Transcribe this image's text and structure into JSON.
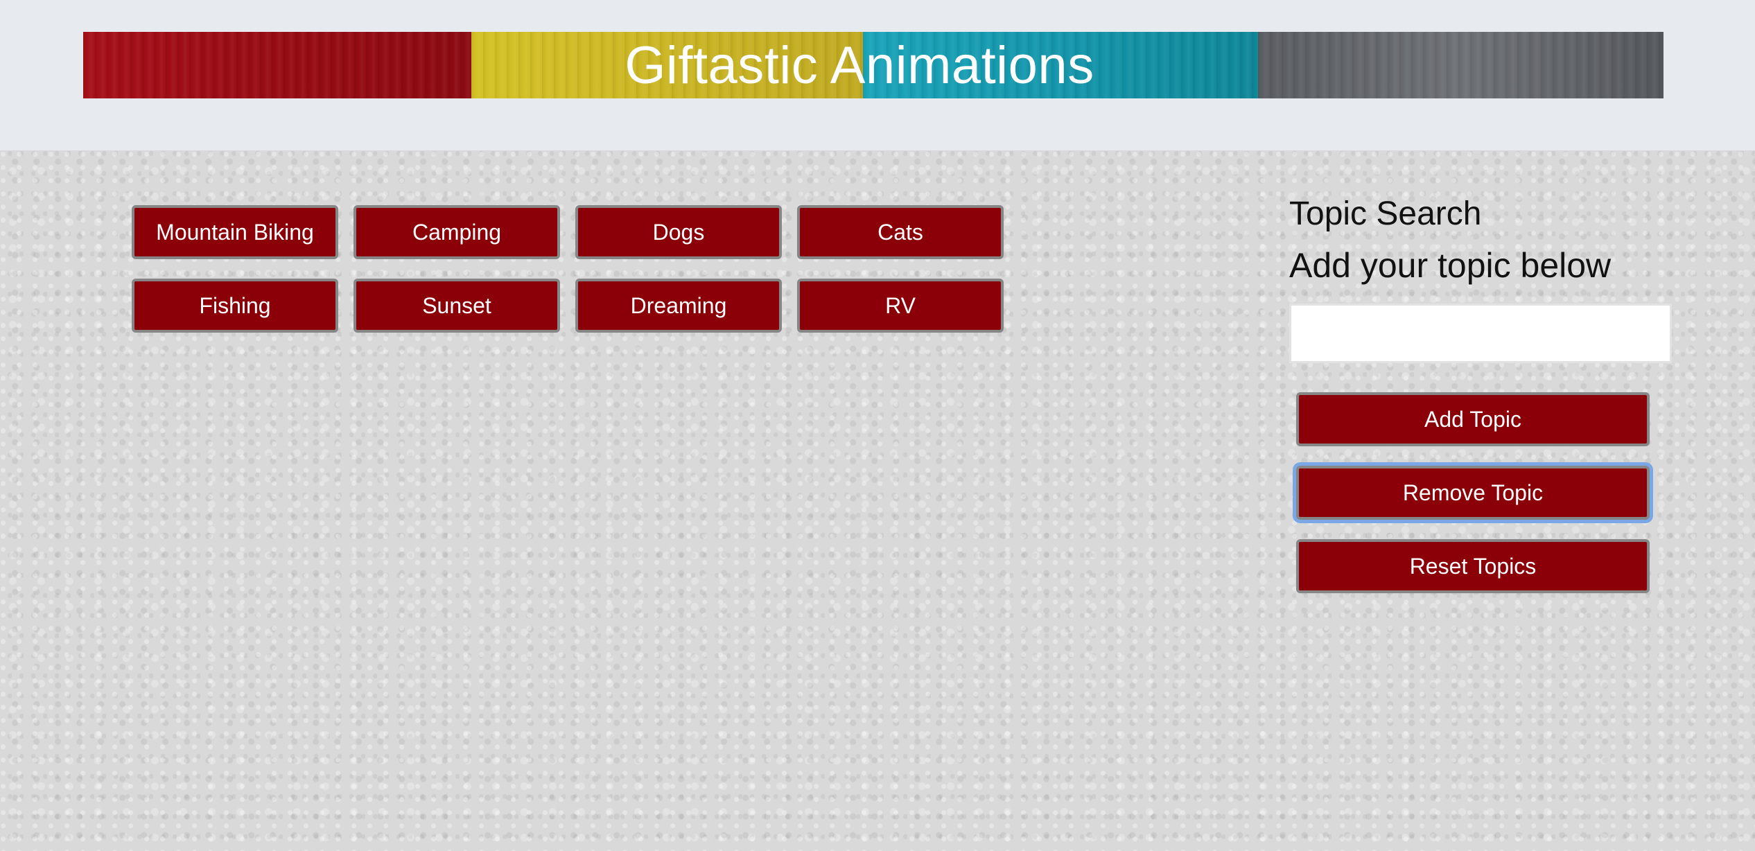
{
  "header": {
    "title": "Giftastic Animations",
    "stripe_colors": [
      "#a60f18",
      "#cbb624",
      "#1596ab",
      "#5f6267"
    ]
  },
  "topics": [
    {
      "label": "Mountain Biking"
    },
    {
      "label": "Camping"
    },
    {
      "label": "Dogs"
    },
    {
      "label": "Cats"
    },
    {
      "label": "Fishing"
    },
    {
      "label": "Sunset"
    },
    {
      "label": "Dreaming"
    },
    {
      "label": "RV"
    }
  ],
  "sidebar": {
    "heading": "Topic Search",
    "subheading": "Add your topic below",
    "input_value": "",
    "add_label": "Add Topic",
    "remove_label": "Remove Topic",
    "reset_label": "Reset Topics"
  },
  "colors": {
    "button_bg": "#8b0008",
    "button_border": "#868686",
    "focus_ring": "#7aa7e6",
    "page_bg": "#e7eaee"
  }
}
